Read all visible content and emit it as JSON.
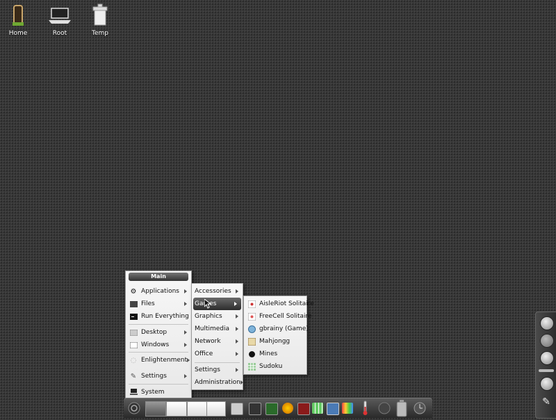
{
  "desktop": {
    "icons": [
      {
        "label": "Home"
      },
      {
        "label": "Root"
      },
      {
        "label": "Temp"
      }
    ]
  },
  "main_menu": {
    "title": "Main",
    "items": [
      {
        "label": "Applications"
      },
      {
        "label": "Files"
      },
      {
        "label": "Run Everything"
      },
      {
        "label": "Desktop"
      },
      {
        "label": "Windows"
      },
      {
        "label": "Enlightenment"
      },
      {
        "label": "Settings"
      },
      {
        "label": "System"
      }
    ]
  },
  "applications_menu": {
    "items": [
      {
        "label": "Accessories"
      },
      {
        "label": "Games"
      },
      {
        "label": "Graphics"
      },
      {
        "label": "Multimedia"
      },
      {
        "label": "Network"
      },
      {
        "label": "Office"
      },
      {
        "label": "Settings"
      },
      {
        "label": "Administration"
      }
    ]
  },
  "games_menu": {
    "items": [
      {
        "label": "AisleRiot Solitaire"
      },
      {
        "label": "FreeCell Solitaire"
      },
      {
        "label": "gbrainy (Game)"
      },
      {
        "label": "Mahjongg"
      },
      {
        "label": "Mines"
      },
      {
        "label": "Sudoku"
      }
    ]
  },
  "icons": {
    "home": "home-icon",
    "root": "laptop-icon",
    "temp": "trash-icon",
    "applications": "gear-icon",
    "files": "folder-icon",
    "run": "terminal-icon",
    "desktop": "desktop-icon",
    "windows": "window-icon",
    "enlightenment": "e-logo-icon",
    "settings": "wrench-icon",
    "system": "computer-icon"
  },
  "colors": {
    "menu_bg": "#eeeeee",
    "menu_highlight": "#3a3a3a",
    "desktop_bg": "#3b3b3b"
  }
}
